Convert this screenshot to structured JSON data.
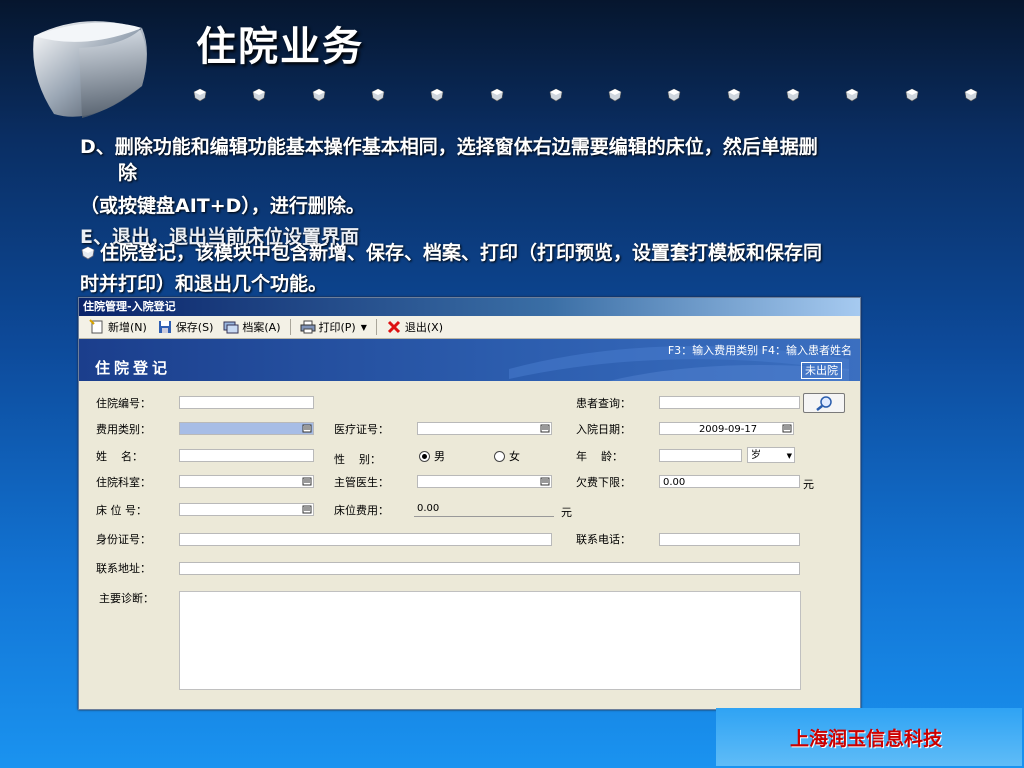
{
  "slide": {
    "title": "住院业务",
    "line_d_1": "D、删除功能和编辑功能基本操作基本相同，选择窗体右边需要编辑的床位，然后单据删",
    "line_d_2": "除",
    "line_d_3": "（或按键盘AIT+D），进行删除。",
    "line_e": "E、退出，退出当前床位设置界面",
    "line_bullet_1": "住院登记，该模块中包含新增、保存、档案、打印（打印预览，设置套打模板和保存同",
    "line_bullet_2": "时并打印）和退出几个功能。",
    "brand": "上海润玉信息科技"
  },
  "dialog": {
    "title": "住院管理-入院登记",
    "toolbar": {
      "new_label": "新增(N)",
      "save_label": "保存(S)",
      "archive_label": "档案(A)",
      "print_label": "打印(P)",
      "exit_label": "退出(X)"
    },
    "banner": {
      "title": "住院登记",
      "hint": "F3：输入费用类别 F4：输入患者姓名",
      "status": "未出院"
    },
    "form": {
      "hospital_no_label": "住院编号：",
      "patient_query_label": "患者查询：",
      "fee_type_label": "费用类别：",
      "medical_card_label": "医疗证号：",
      "admit_date_label": "入院日期：",
      "admit_date_value": "2009-09-17",
      "name_label": "姓    名：",
      "gender_label": "性    别：",
      "gender_male": "男",
      "gender_female": "女",
      "age_label": "年    龄：",
      "age_unit": "岁",
      "dept_label": "住院科室：",
      "doctor_label": "主管医生：",
      "arrears_label": "欠费下限：",
      "arrears_value": "0.00",
      "arrears_unit": "元",
      "bed_label": "床 位 号：",
      "bed_fee_label": "床位费用：",
      "bed_fee_value": "0.00",
      "bed_fee_unit": "元",
      "id_card_label": "身份证号：",
      "phone_label": "联系电话：",
      "address_label": "联系地址：",
      "diagnosis_label": "主要诊断："
    }
  }
}
